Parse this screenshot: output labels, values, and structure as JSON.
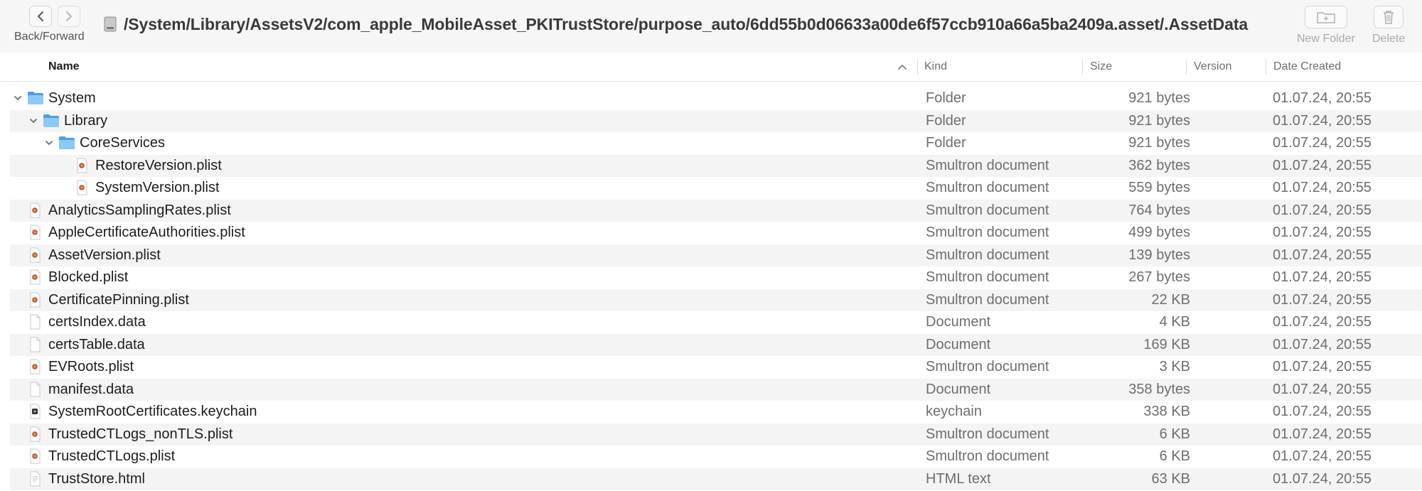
{
  "toolbar": {
    "nav_label": "Back/Forward",
    "path": "/System/Library/AssetsV2/com_apple_MobileAsset_PKITrustStore/purpose_auto/6dd55b0d06633a00de6f57ccb910a66a5ba2409a.asset/.AssetData",
    "new_folder_label": "New Folder",
    "delete_label": "Delete"
  },
  "columns": {
    "name": "Name",
    "kind": "Kind",
    "size": "Size",
    "version": "Version",
    "date": "Date Created"
  },
  "files": [
    {
      "name": "System",
      "kind": "Folder",
      "size": "921 bytes",
      "date": "01.07.24, 20:55",
      "level": 0,
      "icon": "folder-icon",
      "expanded": true
    },
    {
      "name": "Library",
      "kind": "Folder",
      "size": "921 bytes",
      "date": "01.07.24, 20:55",
      "level": 1,
      "icon": "folder-icon",
      "expanded": true
    },
    {
      "name": "CoreServices",
      "kind": "Folder",
      "size": "921 bytes",
      "date": "01.07.24, 20:55",
      "level": 2,
      "icon": "folder-icon",
      "expanded": true
    },
    {
      "name": "RestoreVersion.plist",
      "kind": "Smultron document",
      "size": "362 bytes",
      "date": "01.07.24, 20:55",
      "level": 3,
      "icon": "plist-icon"
    },
    {
      "name": "SystemVersion.plist",
      "kind": "Smultron document",
      "size": "559 bytes",
      "date": "01.07.24, 20:55",
      "level": 3,
      "icon": "plist-icon"
    },
    {
      "name": "AnalyticsSamplingRates.plist",
      "kind": "Smultron document",
      "size": "764 bytes",
      "date": "01.07.24, 20:55",
      "level": 0,
      "icon": "plist-icon"
    },
    {
      "name": "AppleCertificateAuthorities.plist",
      "kind": "Smultron document",
      "size": "499 bytes",
      "date": "01.07.24, 20:55",
      "level": 0,
      "icon": "plist-icon"
    },
    {
      "name": "AssetVersion.plist",
      "kind": "Smultron document",
      "size": "139 bytes",
      "date": "01.07.24, 20:55",
      "level": 0,
      "icon": "plist-icon"
    },
    {
      "name": "Blocked.plist",
      "kind": "Smultron document",
      "size": "267 bytes",
      "date": "01.07.24, 20:55",
      "level": 0,
      "icon": "plist-icon"
    },
    {
      "name": "CertificatePinning.plist",
      "kind": "Smultron document",
      "size": "22 KB",
      "date": "01.07.24, 20:55",
      "level": 0,
      "icon": "plist-icon"
    },
    {
      "name": "certsIndex.data",
      "kind": "Document",
      "size": "4 KB",
      "date": "01.07.24, 20:55",
      "level": 0,
      "icon": "document-icon"
    },
    {
      "name": "certsTable.data",
      "kind": "Document",
      "size": "169 KB",
      "date": "01.07.24, 20:55",
      "level": 0,
      "icon": "document-icon"
    },
    {
      "name": "EVRoots.plist",
      "kind": "Smultron document",
      "size": "3 KB",
      "date": "01.07.24, 20:55",
      "level": 0,
      "icon": "plist-icon"
    },
    {
      "name": "manifest.data",
      "kind": "Document",
      "size": "358 bytes",
      "date": "01.07.24, 20:55",
      "level": 0,
      "icon": "document-icon"
    },
    {
      "name": "SystemRootCertificates.keychain",
      "kind": "keychain",
      "size": "338 KB",
      "date": "01.07.24, 20:55",
      "level": 0,
      "icon": "keychain-icon"
    },
    {
      "name": "TrustedCTLogs_nonTLS.plist",
      "kind": "Smultron document",
      "size": "6 KB",
      "date": "01.07.24, 20:55",
      "level": 0,
      "icon": "plist-icon"
    },
    {
      "name": "TrustedCTLogs.plist",
      "kind": "Smultron document",
      "size": "6 KB",
      "date": "01.07.24, 20:55",
      "level": 0,
      "icon": "plist-icon"
    },
    {
      "name": "TrustStore.html",
      "kind": "HTML text",
      "size": "63 KB",
      "date": "01.07.24, 20:55",
      "level": 0,
      "icon": "html-document-icon"
    }
  ],
  "colors": {
    "folder": "#6db5f5",
    "accent": "#c0562c"
  }
}
